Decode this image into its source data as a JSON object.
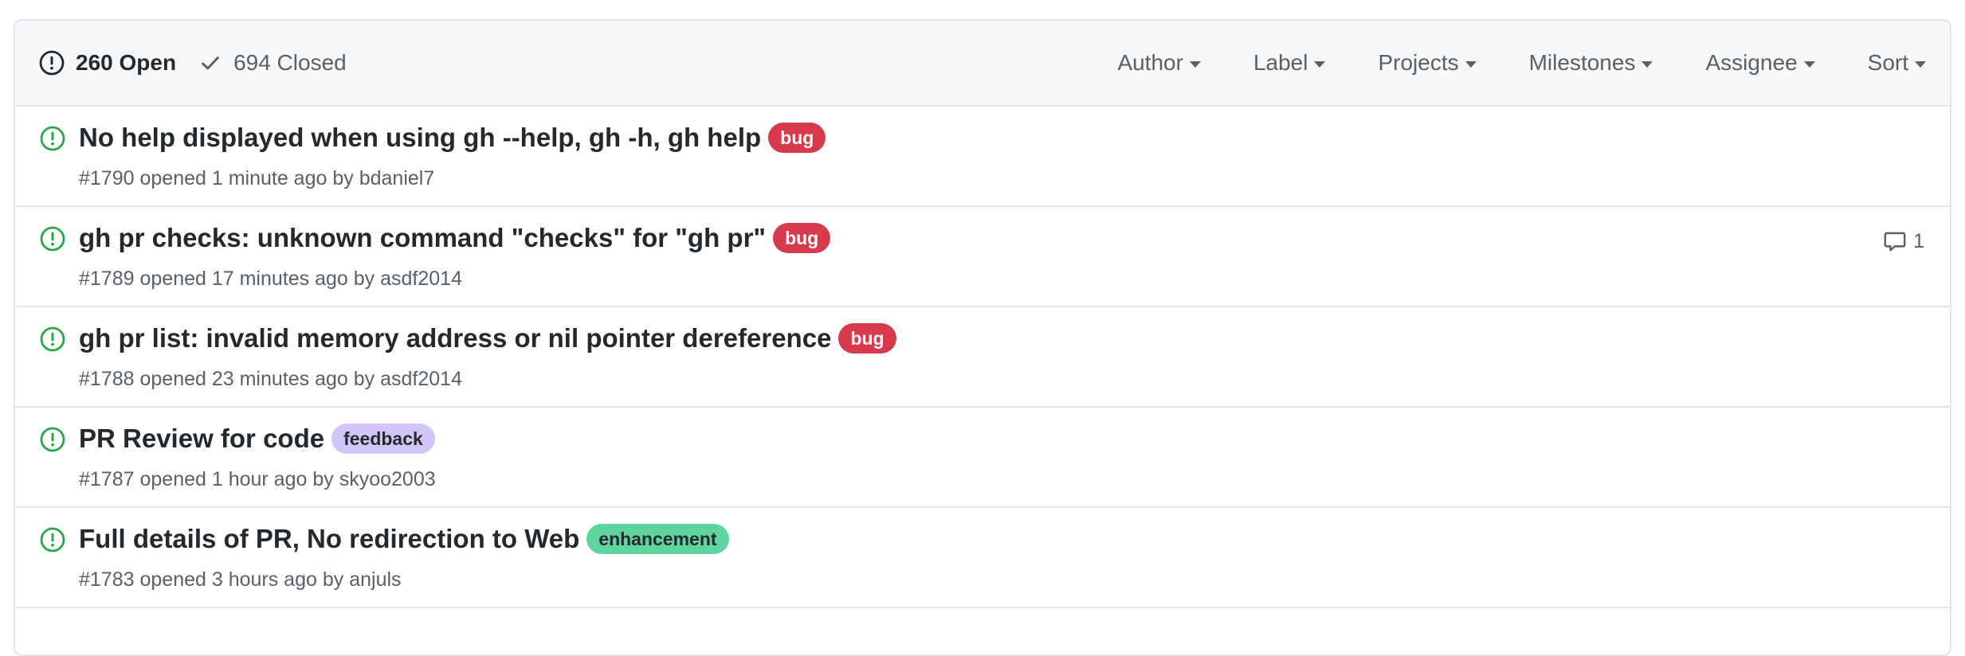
{
  "header": {
    "open_count": "260 Open",
    "closed_count": "694 Closed",
    "filters": [
      "Author",
      "Label",
      "Projects",
      "Milestones",
      "Assignee",
      "Sort"
    ]
  },
  "icons": {
    "open_state": "issue-opened-icon",
    "closed_state": "check-icon",
    "comment": "comment-icon",
    "dropdown": "caret-down-icon"
  },
  "colors": {
    "open_green": "#28a745",
    "bug": "#d73a4a",
    "feedback": "#d4c5f9",
    "enhancement": "#5ed4a0"
  },
  "issues": [
    {
      "title": "No help displayed when using gh --help, gh -h, gh help",
      "label": "bug",
      "number": "#1790",
      "opened": "opened 1 minute ago by",
      "author": "bdaniel7",
      "comments": ""
    },
    {
      "title": "gh pr checks: unknown command \"checks\" for \"gh pr\"",
      "label": "bug",
      "number": "#1789",
      "opened": "opened 17 minutes ago by",
      "author": "asdf2014",
      "comments": "1"
    },
    {
      "title": "gh pr list: invalid memory address or nil pointer dereference",
      "label": "bug",
      "number": "#1788",
      "opened": "opened 23 minutes ago by",
      "author": "asdf2014",
      "comments": ""
    },
    {
      "title": "PR Review for code",
      "label": "feedback",
      "number": "#1787",
      "opened": "opened 1 hour ago by",
      "author": "skyoo2003",
      "comments": ""
    },
    {
      "title": "Full details of PR, No redirection to Web",
      "label": "enhancement",
      "number": "#1783",
      "opened": "opened 3 hours ago by",
      "author": "anjuls",
      "comments": ""
    }
  ]
}
